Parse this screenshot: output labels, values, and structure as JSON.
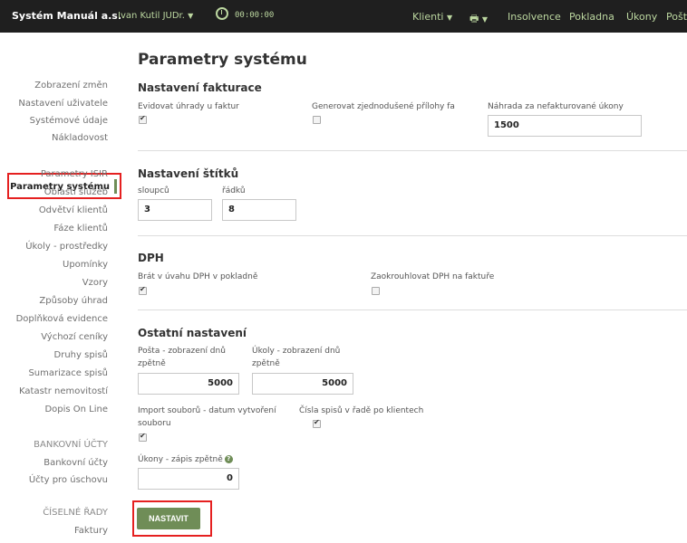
{
  "topbar": {
    "brand": "Systém Manuál a.s.",
    "user": "Ivan Kutil JUDr.",
    "user_chevron": "chevron-down-icon",
    "timer_icon": "stopwatch-icon",
    "timer": "00:00:00",
    "nav": {
      "klienti": "Klienti",
      "printer_icon": "printer-icon",
      "insolvence": "Insolvence",
      "pokladna": "Pokladna",
      "ukony": "Úkony",
      "posta": "Pošt"
    }
  },
  "sidebar": {
    "items": [
      "Zobrazení změn",
      "Nastavení uživatele",
      "Systémové údaje",
      "Nákladovost",
      "Parametry systému",
      "Parametry ISIR",
      "Oblasti služeb",
      "Odvětví klientů",
      "Fáze klientů",
      "Úkoly - prostředky",
      "Upomínky",
      "Vzory",
      "Způsoby úhrad",
      "Doplňková evidence",
      "Výchozí ceníky",
      "Druhy spisů",
      "Sumarizace spisů",
      "Katastr nemovitostí",
      "Dopis On Line"
    ],
    "active": "Parametry systému",
    "bank_heading": "Bankovní účty",
    "bank_items": [
      "Bankovní účty",
      "Účty pro úschovu"
    ],
    "series_heading": "Číselné řady",
    "series_items": [
      "Faktury"
    ]
  },
  "main": {
    "title": "Parametry systému",
    "fakturace": {
      "title": "Nastavení fakturace",
      "evidovat_label": "Evidovat úhrady u faktur",
      "evidovat_checked": true,
      "generovat_label": "Generovat zjednodušené přílohy fa",
      "generovat_checked": false,
      "nahrada_label": "Náhrada za nefakturované úkony",
      "nahrada_value": "1500"
    },
    "stitky": {
      "title": "Nastavení štítků",
      "sloupcu_label": "sloupců",
      "sloupcu_value": "3",
      "radku_label": "řádků",
      "radku_value": "8"
    },
    "dph": {
      "title": "DPH",
      "brat_label": "Brát v úvahu DPH v pokladně",
      "brat_checked": true,
      "zaokrouhlovat_label": "Zaokrouhlovat DPH na faktuře",
      "zaokrouhlovat_checked": false
    },
    "ostatni": {
      "title": "Ostatní nastavení",
      "posta_label_1": "Pošta - zobrazení dnů",
      "posta_label_2": "zpětně",
      "posta_value": "5000",
      "ukoly_label_1": "Úkoly - zobrazení dnů",
      "ukoly_label_2": "zpětně",
      "ukoly_value": "5000",
      "import_label_1": "Import souborů - datum vytvoření",
      "import_label_2": "souboru",
      "import_checked": true,
      "cisla_label": "Čísla spisů v řadě po klientech",
      "cisla_checked": true,
      "ukony_label": "Úkony - zápis zpětně",
      "ukony_help_icon": "help-icon",
      "ukony_help": "?",
      "ukony_value": "0"
    },
    "submit_label": "NASTAVIT"
  }
}
